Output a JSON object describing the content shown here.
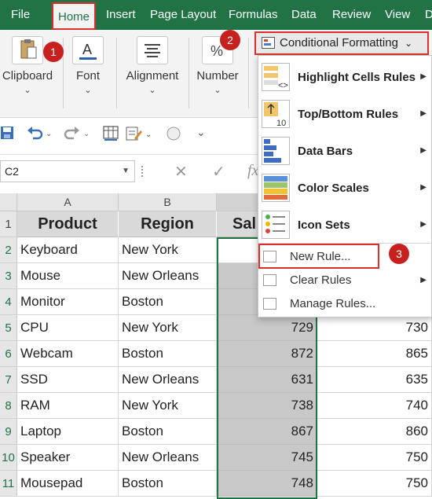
{
  "menu": {
    "items": [
      "File",
      "Home",
      "Insert",
      "Page Layout",
      "Formulas",
      "Data",
      "Review",
      "View",
      "D"
    ]
  },
  "ribbon": {
    "clipboard": "Clipboard",
    "font": "Font",
    "alignment": "Alignment",
    "number": "Number",
    "conditional_formatting": "Conditional Formatting",
    "chevron": "⌄"
  },
  "badges": {
    "b1": "1",
    "b2": "2",
    "b3": "3"
  },
  "namebox": {
    "value": "C2"
  },
  "formula": {
    "fx": "fx"
  },
  "grid": {
    "columns": [
      "A",
      "B"
    ],
    "rows": [
      "1",
      "2",
      "3",
      "4",
      "5",
      "6",
      "7",
      "8",
      "9",
      "10",
      "11"
    ],
    "headers": {
      "a": "Product",
      "b": "Region",
      "c": "Sal"
    },
    "data": [
      {
        "product": "Keyboard",
        "region": "New York",
        "c": "",
        "d": ""
      },
      {
        "product": "Mouse",
        "region": "New Orleans",
        "c": "",
        "d": ""
      },
      {
        "product": "Monitor",
        "region": "Boston",
        "c": "",
        "d": ""
      },
      {
        "product": "CPU",
        "region": "New York",
        "c": "729",
        "d": "730"
      },
      {
        "product": "Webcam",
        "region": "Boston",
        "c": "872",
        "d": "865"
      },
      {
        "product": "SSD",
        "region": "New Orleans",
        "c": "631",
        "d": "635"
      },
      {
        "product": "RAM",
        "region": "New York",
        "c": "738",
        "d": "740"
      },
      {
        "product": "Laptop",
        "region": "Boston",
        "c": "867",
        "d": "860"
      },
      {
        "product": "Speaker",
        "region": "New Orleans",
        "c": "745",
        "d": "750"
      },
      {
        "product": "Mousepad",
        "region": "Boston",
        "c": "748",
        "d": "750"
      }
    ]
  },
  "cf_menu": {
    "highlight": "Highlight Cells Rules",
    "topbottom": "Top/Bottom Rules",
    "databars": "Data Bars",
    "colorscales": "Color Scales",
    "iconsets": "Icon Sets",
    "newrule": "New Rule...",
    "clearrules": "Clear Rules",
    "managerules": "Manage Rules..."
  },
  "colors": {
    "excel_green": "#217346",
    "highlight_red": "#d9302c",
    "badge_red": "#c6201f"
  }
}
